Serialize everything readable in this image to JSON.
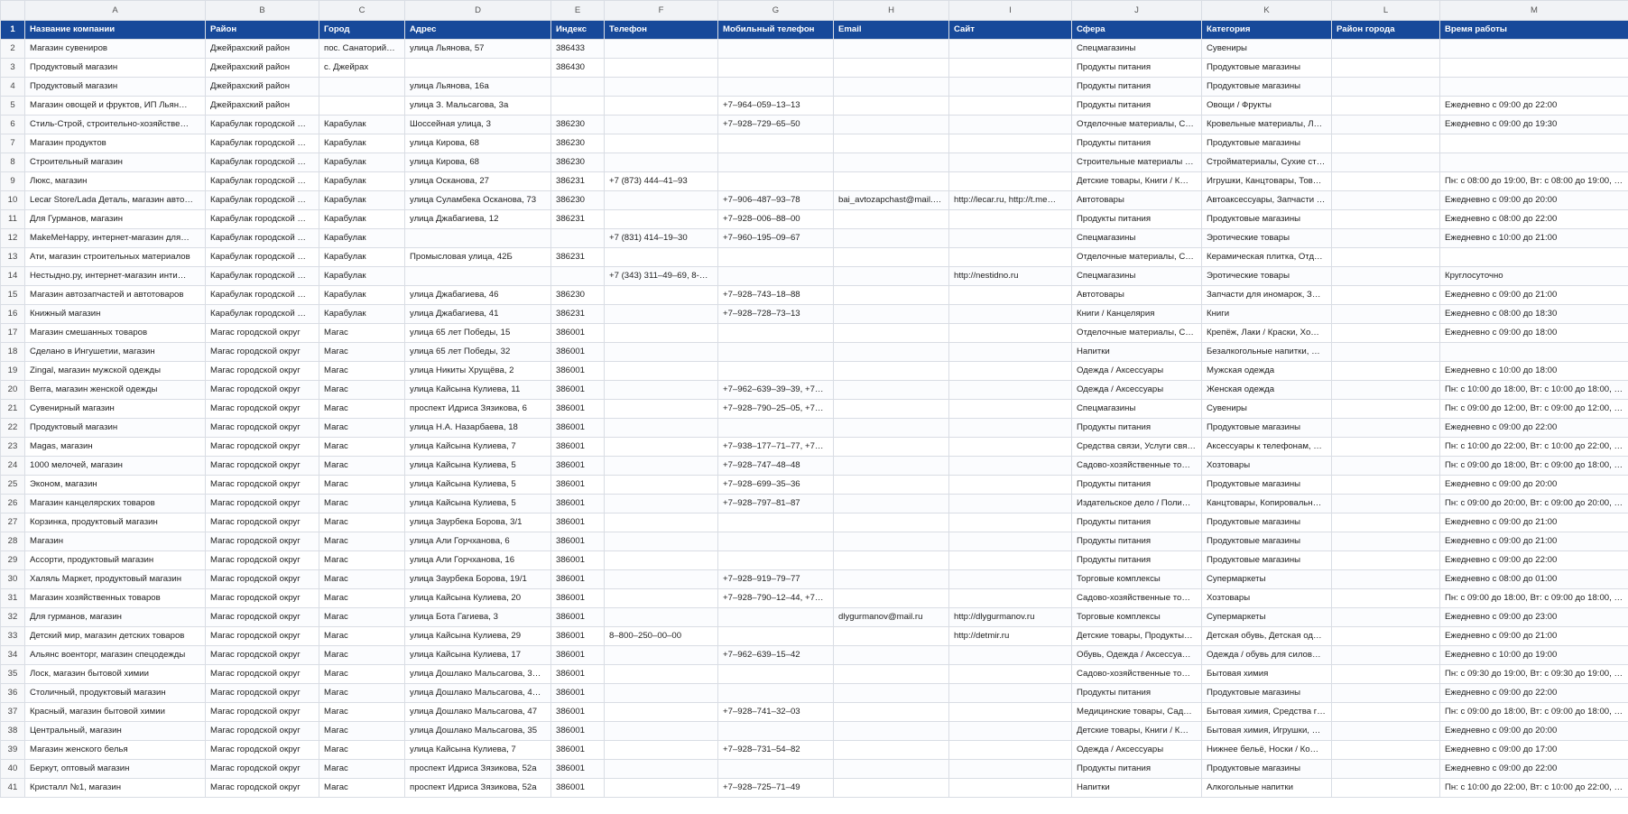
{
  "column_letters": [
    "",
    "A",
    "B",
    "C",
    "D",
    "E",
    "F",
    "G",
    "H",
    "I",
    "J",
    "K",
    "L",
    "M"
  ],
  "header_row_number": "1",
  "headers": [
    "Название компании",
    "Район",
    "Город",
    "Адрес",
    "Индекс",
    "Телефон",
    "Мобильный телефон",
    "Email",
    "Сайт",
    "Сфера",
    "Категория",
    "Район города",
    "Время работы"
  ],
  "rows": [
    [
      "2",
      "Магазин сувениров",
      "Джейрахский район",
      "пос. Санаторий…",
      "улица Льянова, 57",
      "386433",
      "",
      "",
      "",
      "",
      "Спецмагазины",
      "Сувениры",
      "",
      ""
    ],
    [
      "3",
      "Продуктовый магазин",
      "Джейрахский район",
      "с. Джейрах",
      "",
      "386430",
      "",
      "",
      "",
      "",
      "Продукты питания",
      "Продуктовые магазины",
      "",
      ""
    ],
    [
      "4",
      "Продуктовый магазин",
      "Джейрахский район",
      "",
      "улица Льянова, 16а",
      "",
      "",
      "",
      "",
      "",
      "Продукты питания",
      "Продуктовые магазины",
      "",
      ""
    ],
    [
      "5",
      "Магазин овощей и фруктов, ИП Льян…",
      "Джейрахский район",
      "",
      "улица З. Мальсагова, 3а",
      "",
      "",
      "+7‒964‒059‒13‒13",
      "",
      "",
      "Продукты питания",
      "Овощи / Фрукты",
      "",
      "Ежедневно с 09:00 до 22:00"
    ],
    [
      "6",
      "Стиль-Строй, строительно-хозяйстве…",
      "Карабулак городской …",
      "Карабулак",
      "Шоссейная улица, 3",
      "386230",
      "",
      "+7‒928‒729‒65‒50",
      "",
      "",
      "Отделочные материалы, С…",
      "Кровельные материалы, Л…",
      "",
      "Ежедневно с 09:00 до 19:30"
    ],
    [
      "7",
      "Магазин продуктов",
      "Карабулак городской …",
      "Карабулак",
      "улица Кирова, 68",
      "386230",
      "",
      "",
      "",
      "",
      "Продукты питания",
      "Продуктовые магазины",
      "",
      ""
    ],
    [
      "8",
      "Строительный магазин",
      "Карабулак городской …",
      "Карабулак",
      "улица Кирова, 68",
      "386230",
      "",
      "",
      "",
      "",
      "Строительные материалы …",
      "Стройматериалы, Сухие ст…",
      "",
      ""
    ],
    [
      "9",
      "Люкс, магазин",
      "Карабулак городской …",
      "Карабулак",
      "улица Осканова, 27",
      "386231",
      "+7 (873) 444‒41‒93",
      "",
      "",
      "",
      "Детские товары, Книги / К…",
      "Игрушки, Канцтовары, Тов…",
      "",
      "Пн: с 08:00 до 19:00, Вт: с 08:00 до 19:00, С…"
    ],
    [
      "10",
      "Lecar Store/Lada Деталь, магазин авто…",
      "Карабулак городской …",
      "Карабулак",
      "улица Суламбека Осканова, 73",
      "386230",
      "",
      "+7‒906‒487‒93‒78",
      "bai_avtozapchast@mail.…",
      "http://lecar.ru, http://t.me…",
      "Автотовары",
      "Автоаксессуары, Запчасти …",
      "",
      "Ежедневно с 09:00 до 20:00"
    ],
    [
      "11",
      "Для Гурманов, магазин",
      "Карабулак городской …",
      "Карабулак",
      "улица Джабагиева, 12",
      "386231",
      "",
      "+7‒928‒006‒88‒00",
      "",
      "",
      "Продукты питания",
      "Продуктовые магазины",
      "",
      "Ежедневно с 08:00 до 22:00"
    ],
    [
      "12",
      "MakeMeHappy, интернет-магазин для…",
      "Карабулак городской …",
      "Карабулак",
      "",
      "",
      "+7 (831) 414‒19‒30",
      "+7‒960‒195‒09‒67",
      "",
      "",
      "Спецмагазины",
      "Эротические товары",
      "",
      "Ежедневно с 10:00 до 21:00"
    ],
    [
      "13",
      "Ати, магазин строительных материалов",
      "Карабулак городской …",
      "Карабулак",
      "Промысловая улица, 42Б",
      "386231",
      "",
      "",
      "",
      "",
      "Отделочные материалы, С…",
      "Керамическая плитка, Отд…",
      "",
      ""
    ],
    [
      "14",
      "Нестыдно.ру, интернет-магазин инти…",
      "Карабулак городской …",
      "Карабулак",
      "",
      "",
      "+7 (343) 311‒49‒69, 8-…",
      "",
      "",
      "http://nestidno.ru",
      "Спецмагазины",
      "Эротические товары",
      "",
      "Круглосуточно"
    ],
    [
      "15",
      "Магазин автозапчастей и автотоваров",
      "Карабулак городской …",
      "Карабулак",
      "улица Джабагиева, 46",
      "386230",
      "",
      "+7‒928‒743‒18‒88",
      "",
      "",
      "Автотовары",
      "Запчасти для иномарок, З…",
      "",
      "Ежедневно с 09:00 до 21:00"
    ],
    [
      "16",
      "Книжный магазин",
      "Карабулак городской …",
      "Карабулак",
      "улица Джабагиева, 41",
      "386231",
      "",
      "+7‒928‒728‒73‒13",
      "",
      "",
      "Книги / Канцелярия",
      "Книги",
      "",
      "Ежедневно с 08:00 до 18:30"
    ],
    [
      "17",
      "Магазин смешанных товаров",
      "Магас городской округ",
      "Магас",
      "улица 65 лет Победы, 15",
      "386001",
      "",
      "",
      "",
      "",
      "Отделочные материалы, С…",
      "Крепёж, Лаки / Краски, Хо…",
      "",
      "Ежедневно с 09:00 до 18:00"
    ],
    [
      "18",
      "Сделано в Ингушетии, магазин",
      "Магас городской округ",
      "Магас",
      "улица 65 лет Победы, 32",
      "386001",
      "",
      "",
      "",
      "",
      "Напитки",
      "Безалкогольные напитки, …",
      "",
      ""
    ],
    [
      "19",
      "Zingal, магазин мужской одежды",
      "Магас городской округ",
      "Магас",
      "улица Никиты Хрущёва, 2",
      "386001",
      "",
      "",
      "",
      "",
      "Одежда / Аксессуары",
      "Мужская одежда",
      "",
      "Ежедневно с 10:00 до 18:00"
    ],
    [
      "20",
      "Berra, магазин женской одежды",
      "Магас городской округ",
      "Магас",
      "улица Кайсына Кулиева, 11",
      "386001",
      "",
      "+7‒962‒639‒39‒39, +7…",
      "",
      "",
      "Одежда / Аксессуары",
      "Женская одежда",
      "",
      "Пн: с 10:00 до 18:00, Вт: с 10:00 до 18:00, С…"
    ],
    [
      "21",
      "Сувенирный магазин",
      "Магас городской округ",
      "Магас",
      "проспект Идриса Зязикова, 6",
      "386001",
      "",
      "+7‒928‒790‒25‒05, +7…",
      "",
      "",
      "Спецмагазины",
      "Сувениры",
      "",
      "Пн: с 09:00 до 12:00, Вт: с 09:00 до 12:00, С…"
    ],
    [
      "22",
      "Продуктовый магазин",
      "Магас городской округ",
      "Магас",
      "улица Н.А. Назарбаева, 18",
      "386001",
      "",
      "",
      "",
      "",
      "Продукты питания",
      "Продуктовые магазины",
      "",
      "Ежедневно с 09:00 до 22:00"
    ],
    [
      "23",
      "Magas, магазин",
      "Магас городской округ",
      "Магас",
      "улица Кайсына Кулиева, 7",
      "386001",
      "",
      "+7‒938‒177‒71‒77, +7…",
      "",
      "",
      "Средства связи, Услуги свя…",
      "Аксессуары к телефонам, …",
      "",
      "Пн: с 10:00 до 22:00, Вт: с 10:00 до 22:00, С…"
    ],
    [
      "24",
      "1000 мелочей, магазин",
      "Магас городской округ",
      "Магас",
      "улица Кайсына Кулиева, 5",
      "386001",
      "",
      "+7‒928‒747‒48‒48",
      "",
      "",
      "Садово-хозяйственные то…",
      "Хозтовары",
      "",
      "Пн: с 09:00 до 18:00, Вт: с 09:00 до 18:00, С…"
    ],
    [
      "25",
      "Эконом, магазин",
      "Магас городской округ",
      "Магас",
      "улица Кайсына Кулиева, 5",
      "386001",
      "",
      "+7‒928‒699‒35‒36",
      "",
      "",
      "Продукты питания",
      "Продуктовые магазины",
      "",
      "Ежедневно с 09:00 до 20:00"
    ],
    [
      "26",
      "Магазин канцелярских товаров",
      "Магас городской округ",
      "Магас",
      "улица Кайсына Кулиева, 5",
      "386001",
      "",
      "+7‒928‒797‒81‒87",
      "",
      "",
      "Издательское дело / Поли…",
      "Канцтовары, Копировальн…",
      "",
      "Пн: с 09:00 до 20:00, Вт: с 09:00 до 20:00, С…"
    ],
    [
      "27",
      "Корзинка, продуктовый магазин",
      "Магас городской округ",
      "Магас",
      "улица Заурбека Борова, 3/1",
      "386001",
      "",
      "",
      "",
      "",
      "Продукты питания",
      "Продуктовые магазины",
      "",
      "Ежедневно с 09:00 до 21:00"
    ],
    [
      "28",
      "Магазин",
      "Магас городской округ",
      "Магас",
      "улица Али Горчханова, 6",
      "386001",
      "",
      "",
      "",
      "",
      "Продукты питания",
      "Продуктовые магазины",
      "",
      "Ежедневно с 09:00 до 21:00"
    ],
    [
      "29",
      "Ассорти, продуктовый магазин",
      "Магас городской округ",
      "Магас",
      "улица Али Горчханова, 16",
      "386001",
      "",
      "",
      "",
      "",
      "Продукты питания",
      "Продуктовые магазины",
      "",
      "Ежедневно с 09:00 до 22:00"
    ],
    [
      "30",
      "Халяль Маркет, продуктовый магазин",
      "Магас городской округ",
      "Магас",
      "улица Заурбека Борова, 19/1",
      "386001",
      "",
      "+7‒928‒919‒79‒77",
      "",
      "",
      "Торговые комплексы",
      "Супермаркеты",
      "",
      "Ежедневно с 08:00 до 01:00"
    ],
    [
      "31",
      "Магазин хозяйственных товаров",
      "Магас городской округ",
      "Магас",
      "улица Кайсына Кулиева, 20",
      "386001",
      "",
      "+7‒928‒790‒12‒44, +7…",
      "",
      "",
      "Садово-хозяйственные то…",
      "Хозтовары",
      "",
      "Пн: с 09:00 до 18:00, Вт: с 09:00 до 18:00, С…"
    ],
    [
      "32",
      "Для гурманов, магазин",
      "Магас городской округ",
      "Магас",
      "улица Бота Гагиева, 3",
      "386001",
      "",
      "",
      "dlygurmanov@mail.ru",
      "http://dlygurmanov.ru",
      "Торговые комплексы",
      "Супермаркеты",
      "",
      "Ежедневно с 09:00 до 23:00"
    ],
    [
      "33",
      "Детский мир, магазин детских товаров",
      "Магас городской округ",
      "Магас",
      "улица Кайсына Кулиева, 29",
      "386001",
      "8‒800‒250‒00‒00",
      "",
      "",
      "http://detmir.ru",
      "Детские товары, Продукты…",
      "Детская обувь, Детская од…",
      "",
      "Ежедневно с 09:00 до 21:00"
    ],
    [
      "34",
      "Альянс военторг, магазин спецодежды",
      "Магас городской округ",
      "Магас",
      "улица Кайсына Кулиева, 17",
      "386001",
      "",
      "+7‒962‒639‒15‒42",
      "",
      "",
      "Обувь, Одежда / Аксессуа…",
      "Одежда / обувь для силов…",
      "",
      "Ежедневно с 10:00 до 19:00"
    ],
    [
      "35",
      "Лоск, магазин бытовой химии",
      "Магас городской округ",
      "Магас",
      "улица Дошлако Мальсагова, 3…",
      "386001",
      "",
      "",
      "",
      "",
      "Садово-хозяйственные то…",
      "Бытовая химия",
      "",
      "Пн: с 09:30 до 19:00, Вт: с 09:30 до 19:00, С…"
    ],
    [
      "36",
      "Столичный, продуктовый магазин",
      "Магас городской округ",
      "Магас",
      "улица Дошлако Мальсагова, 4…",
      "386001",
      "",
      "",
      "",
      "",
      "Продукты питания",
      "Продуктовые магазины",
      "",
      "Ежедневно с 09:00 до 22:00"
    ],
    [
      "37",
      "Красный, магазин бытовой химии",
      "Магас городской округ",
      "Магас",
      "улица Дошлако Мальсагова, 47",
      "386001",
      "",
      "+7‒928‒741‒32‒03",
      "",
      "",
      "Медицинские товары, Сад…",
      "Бытовая химия, Средства г…",
      "",
      "Пн: с 09:00 до 18:00, Вт: с 09:00 до 18:00, С…"
    ],
    [
      "38",
      "Центральный, магазин",
      "Магас городской округ",
      "Магас",
      "улица Дошлако Мальсагова, 35",
      "386001",
      "",
      "",
      "",
      "",
      "Детские товары, Книги / К…",
      "Бытовая химия, Игрушки, …",
      "",
      "Ежедневно с 09:00 до 20:00"
    ],
    [
      "39",
      "Магазин женского белья",
      "Магас городской округ",
      "Магас",
      "улица Кайсына Кулиева, 7",
      "386001",
      "",
      "+7‒928‒731‒54‒82",
      "",
      "",
      "Одежда / Аксессуары",
      "Нижнее бельё, Носки / Ко…",
      "",
      "Ежедневно с 09:00 до 17:00"
    ],
    [
      "40",
      "Беркут, оптовый магазин",
      "Магас городской округ",
      "Магас",
      "проспект Идриса Зязикова, 52а",
      "386001",
      "",
      "",
      "",
      "",
      "Продукты питания",
      "Продуктовые магазины",
      "",
      "Ежедневно с 09:00 до 22:00"
    ],
    [
      "41",
      "Кристалл №1, магазин",
      "Магас городской округ",
      "Магас",
      "проспект Идриса Зязикова, 52а",
      "386001",
      "",
      "+7‒928‒725‒71‒49",
      "",
      "",
      "Напитки",
      "Алкогольные напитки",
      "",
      "Пн: с 10:00 до 22:00, Вт: с 10:00 до 22:00, С…"
    ]
  ],
  "colors": {
    "header_bg": "#17499a",
    "header_text": "#ffffff",
    "grid": "#d9dde4",
    "letters_bg": "#f1f3f6"
  }
}
